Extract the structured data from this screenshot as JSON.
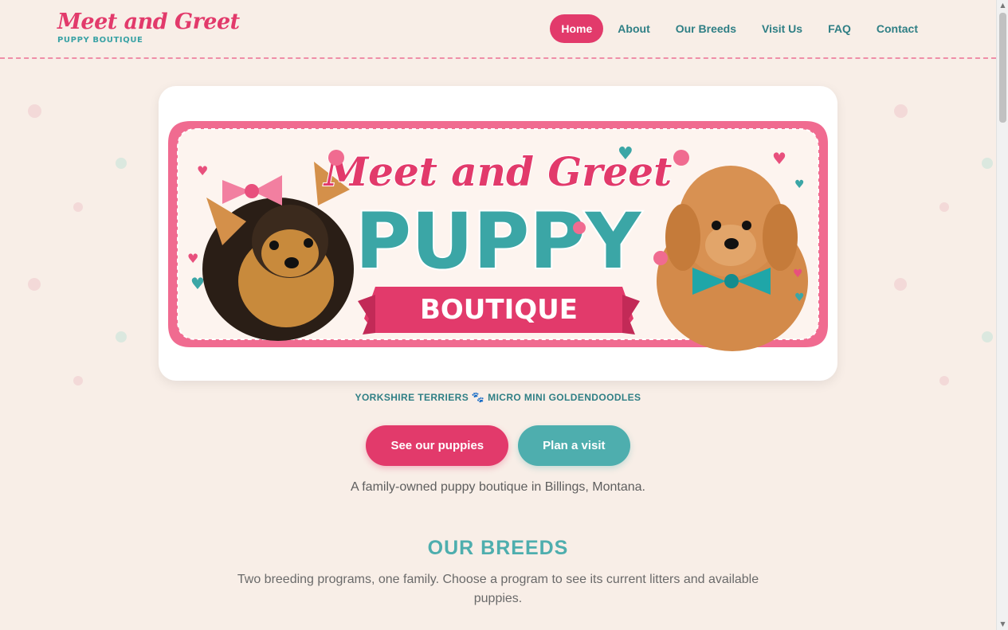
{
  "brand": {
    "script": "Meet and Greet",
    "sub": "PUPPY BOUTIQUE"
  },
  "nav": {
    "items": [
      {
        "label": "Home",
        "active": true
      },
      {
        "label": "About",
        "active": false
      },
      {
        "label": "Our Breeds",
        "active": false
      },
      {
        "label": "Visit Us",
        "active": false
      },
      {
        "label": "FAQ",
        "active": false
      },
      {
        "label": "Contact",
        "active": false
      }
    ]
  },
  "hero": {
    "banner_top": "Meet and Greet",
    "banner_main": "PUPPY",
    "banner_ribbon": "BOUTIQUE",
    "tagline_left": "YORKSHIRE TERRIERS",
    "tagline_icon": "paw-prints-icon",
    "tagline_right": "MICRO MINI GOLDENDOODLES",
    "cta_primary": "See our puppies",
    "cta_secondary": "Plan a visit",
    "intro": "A family-owned puppy boutique in Billings, Montana."
  },
  "breeds": {
    "title": "OUR BREEDS",
    "subtitle": "Two breeding programs, one family. Choose a program to see its current litters and available puppies."
  },
  "colors": {
    "background": "#f8eee7",
    "pink": "#e23a6b",
    "teal": "#4eaeae",
    "dark_teal": "#2f7f85"
  }
}
